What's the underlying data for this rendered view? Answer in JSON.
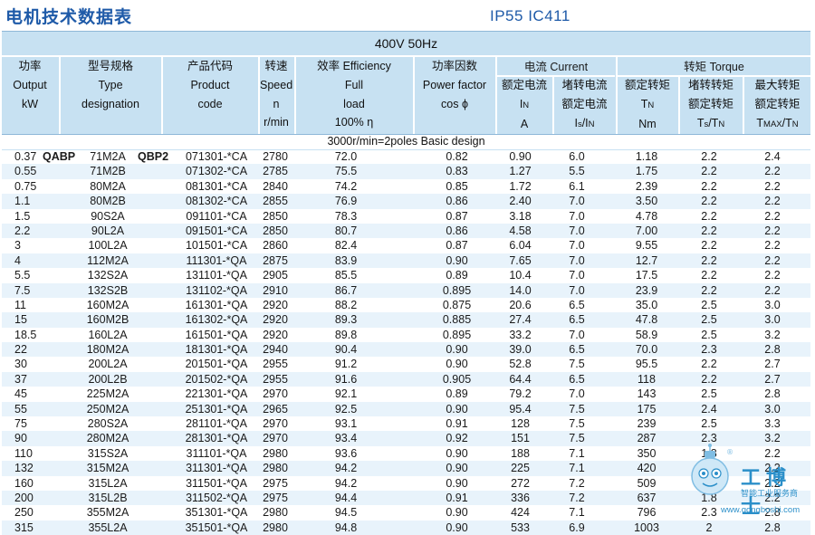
{
  "header": {
    "title": "电机技术数据表",
    "protection": "IP55  IC411",
    "voltage": "400V 50Hz"
  },
  "columns": {
    "output": [
      "功率",
      "Output",
      "kW"
    ],
    "type": [
      "型号规格",
      "Type",
      "designation"
    ],
    "code": [
      "产品代码",
      "Product",
      "code"
    ],
    "speed": [
      "转速",
      "Speed",
      "n",
      "r/min"
    ],
    "efficiency": [
      "效率 Efficiency",
      "Full",
      "load",
      "100% η"
    ],
    "power_factor": [
      "功率因数",
      "Power factor",
      "cos ϕ"
    ],
    "current_group": "电流 Current",
    "rated_current": [
      "额定电流",
      "IN",
      "A"
    ],
    "locked_current": [
      "堵转电流",
      "额定电流",
      "Is/IN"
    ],
    "torque_group": "转矩 Torque",
    "rated_torque": [
      "额定转矩",
      "TN",
      "Nm"
    ],
    "locked_torque": [
      "堵转转矩",
      "额定转矩",
      "Ts/TN"
    ],
    "max_torque": [
      "最大转矩",
      "额定转矩",
      "TMAX/TN"
    ]
  },
  "design_label": "3000r/min=2poles Basic design",
  "series": {
    "left": "QABP",
    "right": "QBP2"
  },
  "rows": [
    [
      "0.37",
      "71M2A",
      "071301-*CA",
      "2780",
      "72.0",
      "0.82",
      "0.90",
      "6.0",
      "1.18",
      "2.2",
      "2.4"
    ],
    [
      "0.55",
      "71M2B",
      "071302-*CA",
      "2785",
      "75.5",
      "0.83",
      "1.27",
      "5.5",
      "1.75",
      "2.2",
      "2.2"
    ],
    [
      "0.75",
      "80M2A",
      "081301-*CA",
      "2840",
      "74.2",
      "0.85",
      "1.72",
      "6.1",
      "2.39",
      "2.2",
      "2.2"
    ],
    [
      "1.1",
      "80M2B",
      "081302-*CA",
      "2855",
      "76.9",
      "0.86",
      "2.40",
      "7.0",
      "3.50",
      "2.2",
      "2.2"
    ],
    [
      "1.5",
      "90S2A",
      "091101-*CA",
      "2850",
      "78.3",
      "0.87",
      "3.18",
      "7.0",
      "4.78",
      "2.2",
      "2.2"
    ],
    [
      "2.2",
      "90L2A",
      "091501-*CA",
      "2850",
      "80.7",
      "0.86",
      "4.58",
      "7.0",
      "7.00",
      "2.2",
      "2.2"
    ],
    [
      "3",
      "100L2A",
      "101501-*CA",
      "2860",
      "82.4",
      "0.87",
      "6.04",
      "7.0",
      "9.55",
      "2.2",
      "2.2"
    ],
    [
      "4",
      "112M2A",
      "111301-*QA",
      "2875",
      "83.9",
      "0.90",
      "7.65",
      "7.0",
      "12.7",
      "2.2",
      "2.2"
    ],
    [
      "5.5",
      "132S2A",
      "131101-*QA",
      "2905",
      "85.5",
      "0.89",
      "10.4",
      "7.0",
      "17.5",
      "2.2",
      "2.2"
    ],
    [
      "7.5",
      "132S2B",
      "131102-*QA",
      "2910",
      "86.7",
      "0.895",
      "14.0",
      "7.0",
      "23.9",
      "2.2",
      "2.2"
    ],
    [
      "11",
      "160M2A",
      "161301-*QA",
      "2920",
      "88.2",
      "0.875",
      "20.6",
      "6.5",
      "35.0",
      "2.5",
      "3.0"
    ],
    [
      "15",
      "160M2B",
      "161302-*QA",
      "2920",
      "89.3",
      "0.885",
      "27.4",
      "6.5",
      "47.8",
      "2.5",
      "3.0"
    ],
    [
      "18.5",
      "160L2A",
      "161501-*QA",
      "2920",
      "89.8",
      "0.895",
      "33.2",
      "7.0",
      "58.9",
      "2.5",
      "3.2"
    ],
    [
      "22",
      "180M2A",
      "181301-*QA",
      "2940",
      "90.4",
      "0.90",
      "39.0",
      "6.5",
      "70.0",
      "2.3",
      "2.8"
    ],
    [
      "30",
      "200L2A",
      "201501-*QA",
      "2955",
      "91.2",
      "0.90",
      "52.8",
      "7.5",
      "95.5",
      "2.2",
      "2.7"
    ],
    [
      "37",
      "200L2B",
      "201502-*QA",
      "2955",
      "91.6",
      "0.905",
      "64.4",
      "6.5",
      "118",
      "2.2",
      "2.7"
    ],
    [
      "45",
      "225M2A",
      "221301-*QA",
      "2970",
      "92.1",
      "0.89",
      "79.2",
      "7.0",
      "143",
      "2.5",
      "2.8"
    ],
    [
      "55",
      "250M2A",
      "251301-*QA",
      "2965",
      "92.5",
      "0.90",
      "95.4",
      "7.5",
      "175",
      "2.4",
      "3.0"
    ],
    [
      "75",
      "280S2A",
      "281101-*QA",
      "2970",
      "93.1",
      "0.91",
      "128",
      "7.5",
      "239",
      "2.5",
      "3.3"
    ],
    [
      "90",
      "280M2A",
      "281301-*QA",
      "2970",
      "93.4",
      "0.92",
      "151",
      "7.5",
      "287",
      "2.3",
      "3.2"
    ],
    [
      "110",
      "315S2A",
      "311101-*QA",
      "2980",
      "93.6",
      "0.90",
      "188",
      "7.1",
      "350",
      "1.8",
      "2.2"
    ],
    [
      "132",
      "315M2A",
      "311301-*QA",
      "2980",
      "94.2",
      "0.90",
      "225",
      "7.1",
      "420",
      "1.8",
      "2.2"
    ],
    [
      "160",
      "315L2A",
      "311501-*QA",
      "2975",
      "94.2",
      "0.90",
      "272",
      "7.2",
      "509",
      "1.8",
      "2.2"
    ],
    [
      "200",
      "315L2B",
      "311502-*QA",
      "2975",
      "94.4",
      "0.91",
      "336",
      "7.2",
      "637",
      "1.8",
      "2.2"
    ],
    [
      "250",
      "355M2A",
      "351301-*QA",
      "2980",
      "94.5",
      "0.90",
      "424",
      "7.1",
      "796",
      "2.3",
      "2.8"
    ],
    [
      "315",
      "355L2A",
      "351501-*QA",
      "2980",
      "94.8",
      "0.90",
      "533",
      "6.9",
      "1003",
      "2",
      "2.8"
    ]
  ],
  "watermark": {
    "name": "工博士",
    "tagline": "智能工业服务商",
    "url": "www.gongboshi.com"
  },
  "colors": {
    "title_blue": "#1e5aa8",
    "header_fill": "#c7e1f2",
    "row_alt": "#e8f3fb",
    "watermark": "#2b8fc9"
  }
}
